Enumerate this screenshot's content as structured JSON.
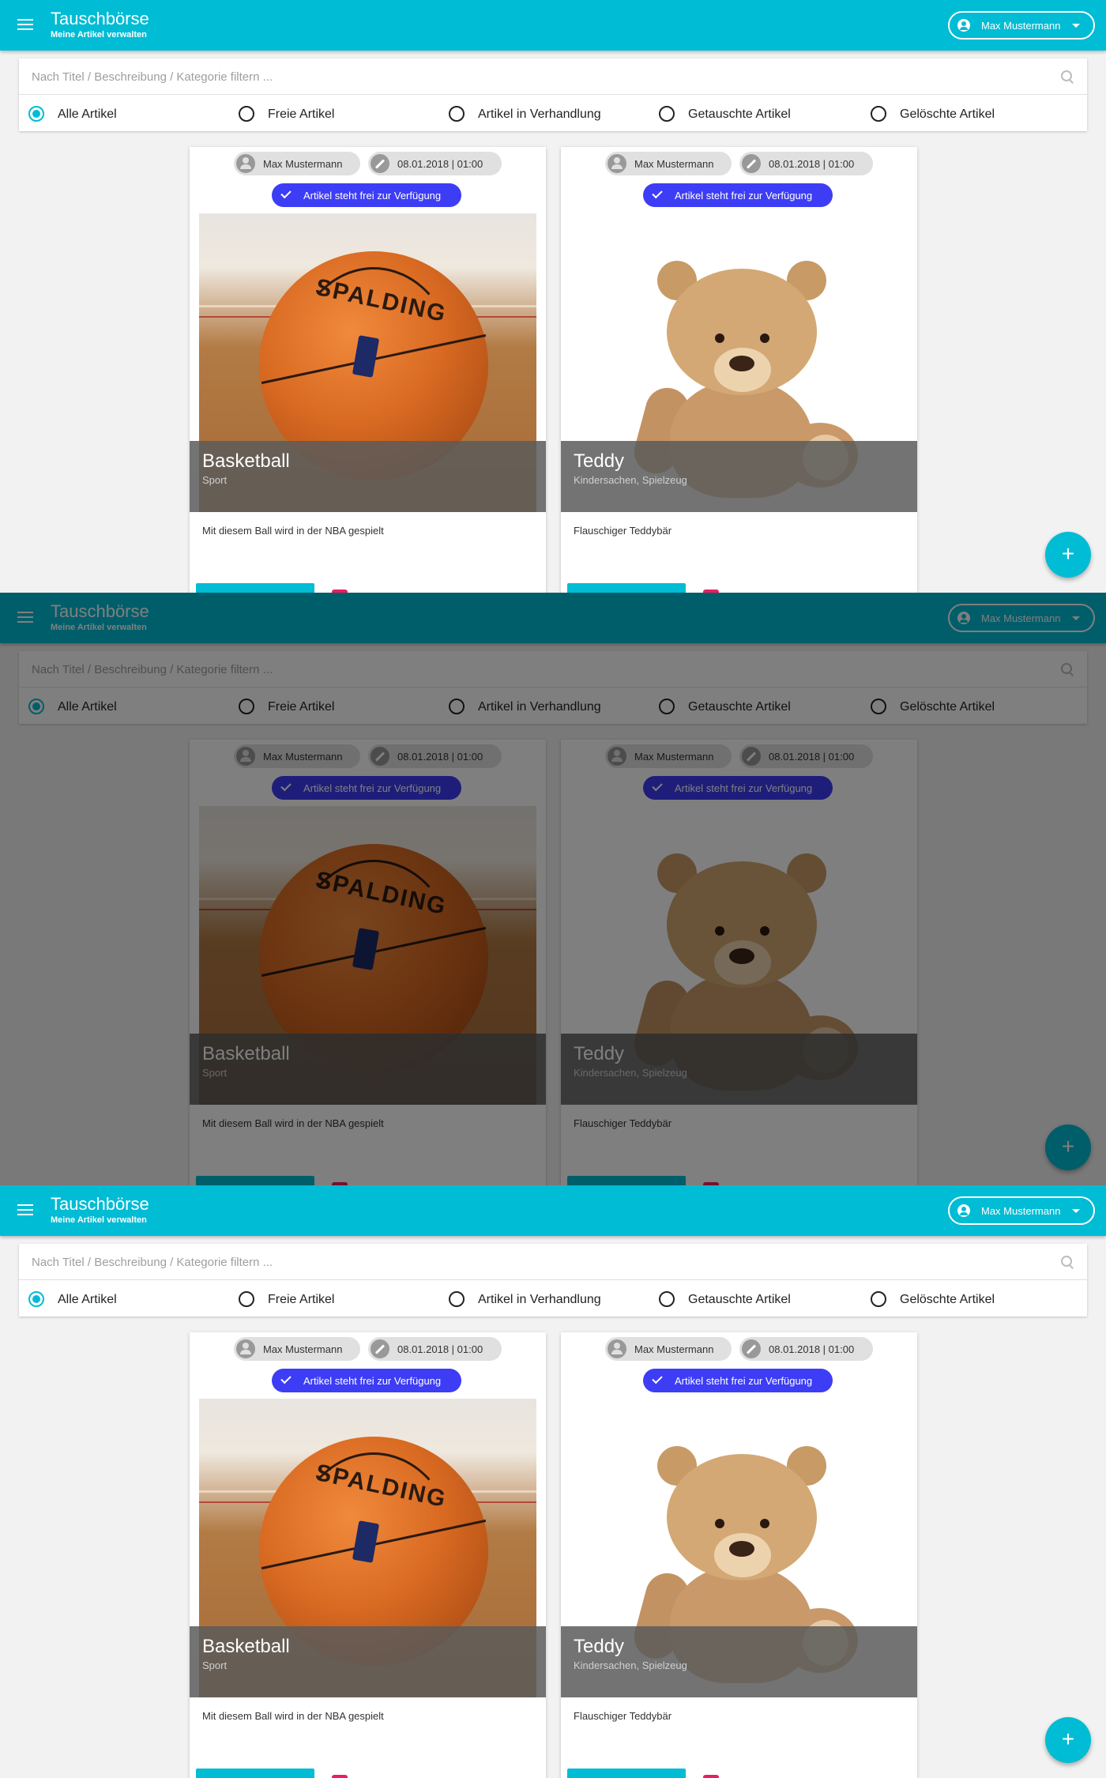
{
  "app": {
    "title": "Tauschbörse",
    "subtitle": "Meine Artikel verwalten",
    "user_button": "Max Mustermann"
  },
  "filter": {
    "search_placeholder": "Nach Titel / Beschreibung / Kategorie filtern ...",
    "options": [
      "Alle Artikel",
      "Freie Artikel",
      "Artikel in Verhandlung",
      "Getauschte Artikel",
      "Gelöschte Artikel"
    ],
    "selected": "Alle Artikel"
  },
  "items": [
    {
      "owner": "Max Mustermann",
      "date": "08.01.2018 | 01:00",
      "status": "Artikel steht frei zur Verfügung",
      "title": "Basketball",
      "category": "Sport",
      "description": "Mit diesem Ball wird in der NBA gespielt",
      "image_brand": "SPALDING"
    },
    {
      "owner": "Max Mustermann",
      "date": "08.01.2018 | 01:00",
      "status": "Artikel steht frei zur Verfügung",
      "title": "Teddy",
      "category": "Kindersachen, Spielzeug",
      "description": "Flauschiger Teddybär"
    }
  ],
  "fab_label": "+",
  "colors": {
    "primary": "#00bcd4",
    "status_chip": "#3d3df5",
    "delete": "#e91e63"
  }
}
